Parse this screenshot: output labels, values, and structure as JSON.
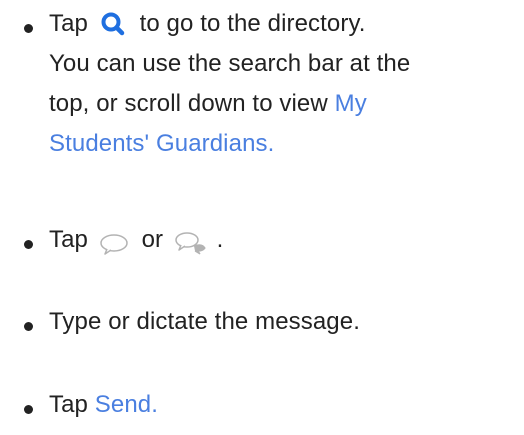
{
  "steps": [
    {
      "prefix": "Tap",
      "icon": "search-icon",
      "text_after_icon": "to go to the directory.",
      "line2": "You can use the search bar at the",
      "line3_plain": "top, or scroll down to view",
      "link_part1": "My",
      "link_part2": "Students' Guardians."
    },
    {
      "prefix": "Tap",
      "icon1": "speech-bubble-icon",
      "conjunction": "or",
      "icon2": "double-speech-bubble-icon",
      "suffix": "."
    },
    {
      "text": "Type or dictate the message."
    },
    {
      "prefix": "Tap",
      "link": "Send."
    }
  ],
  "colors": {
    "link": "#4a7fe0",
    "search_icon": "#1f6fe0",
    "bubble_icon": "#b3b3b3",
    "text": "#222222"
  }
}
